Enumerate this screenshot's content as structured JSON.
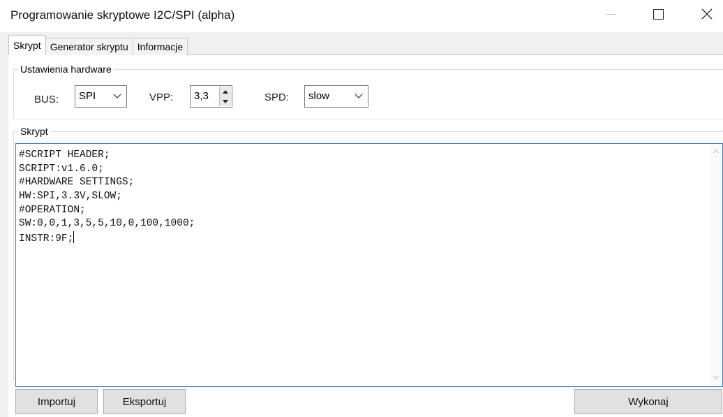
{
  "window": {
    "title": "Programowanie skryptowe I2C/SPI (alpha)",
    "controls": {
      "minimize_icon": "minimize-icon",
      "maximize_icon": "maximize-icon",
      "close_icon": "close-icon",
      "close_glyph": "✕"
    }
  },
  "tabs": [
    {
      "label": "Skrypt",
      "active": true
    },
    {
      "label": "Generator skryptu",
      "active": false
    },
    {
      "label": "Informacje",
      "active": false
    }
  ],
  "hardware": {
    "group_label": "Ustawienia hardware",
    "bus_label": "BUS:",
    "bus_value": "SPI",
    "vpp_label": "VPP:",
    "vpp_value": "3,3",
    "spd_label": "SPD:",
    "spd_value": "slow"
  },
  "script": {
    "group_label": "Skrypt",
    "lines": [
      "#SCRIPT HEADER;",
      "SCRIPT:v1.6.0;",
      "#HARDWARE SETTINGS;",
      "HW:SPI,3.3V,SLOW;",
      "#OPERATION;",
      "SW:0,0,1,3,5,5,10,0,100,1000;",
      "INSTR:9F;"
    ]
  },
  "buttons": {
    "import": "Importuj",
    "export": "Eksportuj",
    "run": "Wykonaj"
  },
  "colors": {
    "editor_border": "#2f83d4",
    "window_bg": "#f0f0f0",
    "button_bg": "#e1e1e1"
  }
}
